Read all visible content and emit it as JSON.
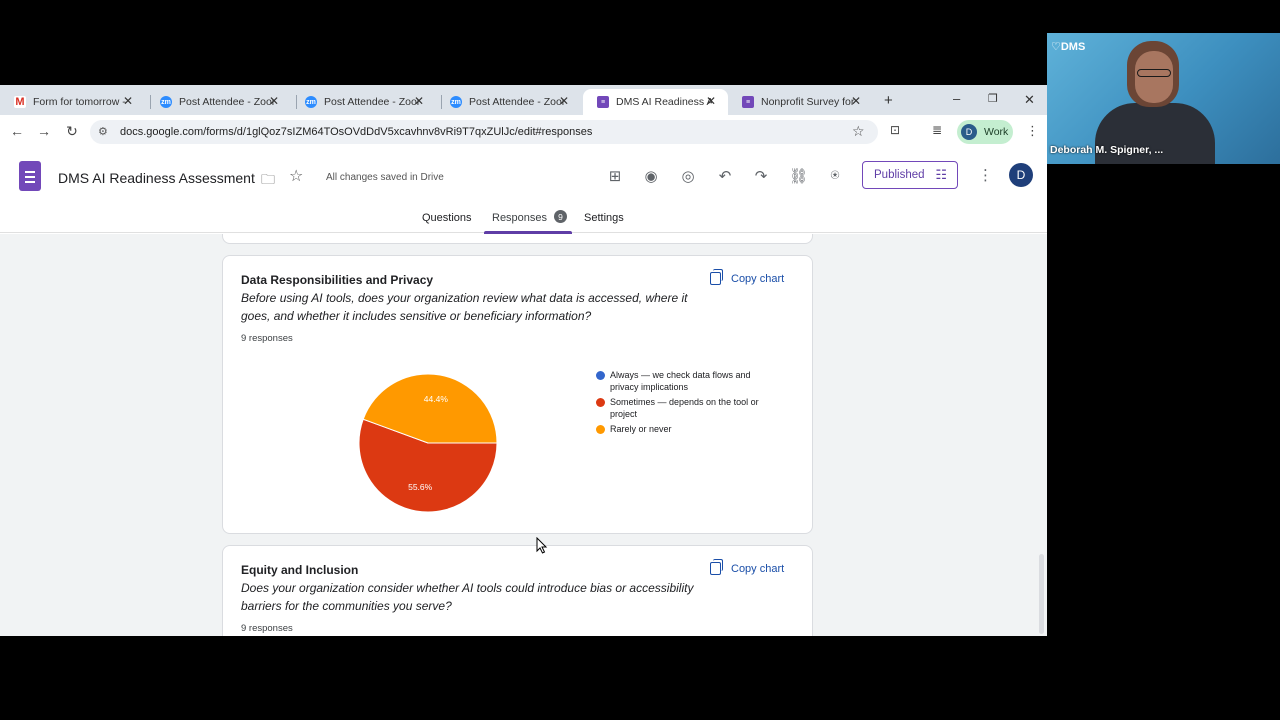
{
  "browser": {
    "tabs": [
      {
        "title": "Form for tomorrow - c",
        "favicon": "gmail-icon",
        "active": false
      },
      {
        "title": "Post Attendee - Zoom",
        "favicon": "zoom-icon",
        "active": false
      },
      {
        "title": "Post Attendee - Zoom",
        "favicon": "zoom-icon",
        "active": false
      },
      {
        "title": "Post Attendee - Zoom",
        "favicon": "zoom-icon",
        "active": false
      },
      {
        "title": "DMS AI Readiness Ass",
        "favicon": "forms-icon",
        "active": true
      },
      {
        "title": "Nonprofit Survey for (",
        "favicon": "forms-icon",
        "active": false
      }
    ],
    "new_tab": "+",
    "url": "docs.google.com/forms/d/1glQoz7sIZM64TOsOVdDdV5xcavhnv8vRi9T7qxZUlJc/edit#responses",
    "profile_label": "Work",
    "profile_initial": "D"
  },
  "form": {
    "title": "DMS AI Readiness Assessment",
    "save_status": "All changes saved in Drive",
    "published_label": "Published",
    "account_initial": "D",
    "tabs": {
      "questions": "Questions",
      "responses": "Responses",
      "responses_count": "9",
      "settings": "Settings"
    }
  },
  "cards": {
    "privacy": {
      "title": "Data Responsibilities and Privacy",
      "question": "Before using AI tools, does your organization review what data is accessed, where it goes, and whether it includes sensitive or beneficiary information?",
      "responses": "9 responses",
      "copy_label": "Copy chart"
    },
    "equity": {
      "title": "Equity and Inclusion",
      "question": "Does your organization consider whether AI tools could introduce bias or accessibility barriers for the communities you serve?",
      "responses": "9 responses",
      "copy_label": "Copy chart"
    }
  },
  "chart_data": {
    "type": "pie",
    "categories": [
      "Always — we check data flows and privacy implications",
      "Sometimes — depends on the tool or project",
      "Rarely or never"
    ],
    "values": [
      0,
      55.6,
      44.4
    ],
    "data_labels": [
      "",
      "55.6%",
      "44.4%"
    ],
    "colors": [
      "#3366cc",
      "#dc3912",
      "#ff9900"
    ],
    "legend_position": "right"
  },
  "video": {
    "brand": "♡DMS",
    "speaker": "Deborah M. Spigner, ..."
  }
}
